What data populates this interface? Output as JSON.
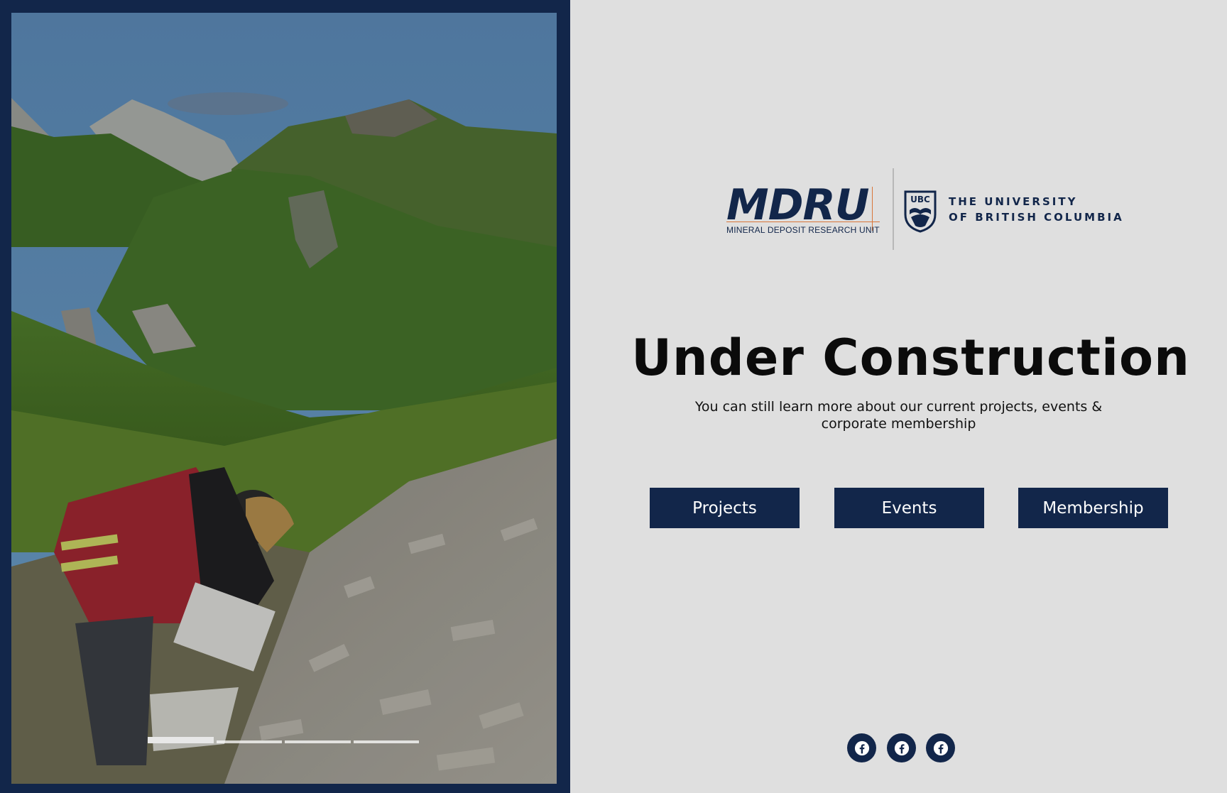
{
  "logo": {
    "mdru_text": "MDRU",
    "mdru_subtitle": "MINERAL DEPOSIT RESEARCH UNIT",
    "ubc_crest_text": "UBC",
    "ubc_line1": "THE UNIVERSITY",
    "ubc_line2": "OF BRITISH COLUMBIA"
  },
  "hero": {
    "title": "Under Construction",
    "subtitle": "You can still learn more about our current projects, events & corporate membership"
  },
  "buttons": {
    "projects": "Projects",
    "events": "Events",
    "membership": "Membership"
  },
  "slideshow": {
    "slide_count": 4,
    "active_index": 0,
    "image_icon": "field-geologist-mountain-photo"
  },
  "social": {
    "icons": [
      "facebook-icon",
      "facebook-icon",
      "facebook-icon"
    ]
  },
  "colors": {
    "brand_navy": "#12264a",
    "background": "#dfdfdf",
    "accent_orange": "#d9773a"
  }
}
